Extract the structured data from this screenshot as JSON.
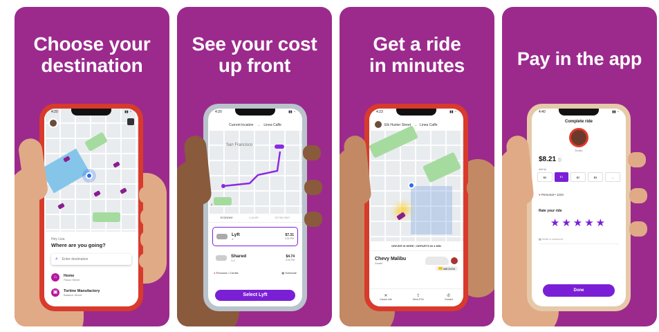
{
  "colors": {
    "panel_bg": "#9c2a8c",
    "accent_purple": "#7b1fd6",
    "phone_red": "#d83a2c",
    "phone_silver": "#b9c3cc",
    "phone_gold": "#e6c9a8"
  },
  "panels": [
    {
      "title": "Choose your\ndestination",
      "screen": {
        "status_time": "4:20",
        "greeting": "Hey Lisa",
        "question": "Where are you going?",
        "search_placeholder": "Enter destination",
        "places": [
          {
            "name": "Home",
            "sub": "Pasco Street",
            "icon": "home-icon"
          },
          {
            "name": "Tortine Manufactory",
            "sub": "Balance Street",
            "icon": "briefcase-icon"
          }
        ]
      }
    },
    {
      "title": "See your cost\nup front",
      "screen": {
        "status_time": "4:20",
        "route_from": "Current location",
        "route_to": "Linea Caffe",
        "map_label": "San Francisco",
        "modes": [
          "ECONOMY",
          "LUXURY",
          "EXTRA SEAT"
        ],
        "options": [
          {
            "name": "Lyft",
            "seats": "4",
            "price": "$7.31",
            "eta": "4:32 PM"
          },
          {
            "name": "Shared",
            "seats": "1-2",
            "price": "$4.74",
            "eta": "4:40 PM"
          }
        ],
        "payment": "Personal • Credits",
        "schedule": "Schedule",
        "cta": "Select Lyft"
      }
    },
    {
      "title": "Get a ride\nin minutes",
      "screen": {
        "status_time": "4:23",
        "route_from": "Elk Hunter Street",
        "route_to": "Linea Caffe",
        "banner": "DRIVER IS HERE • DEPARTS IN 4 MIN",
        "car": "Chevy Malibu",
        "driver": "Dustin",
        "plate": "ABC0234",
        "actions": [
          "Cancel ride",
          "Send ETA",
          "Contact"
        ]
      }
    },
    {
      "title": "Pay in the app",
      "screen": {
        "status_time": "4:40",
        "header": "Complete ride",
        "driver": "Dustin",
        "total": "$8.21",
        "tip_label": "Add tip",
        "tips": [
          "$0",
          "$1",
          "$2",
          "$5",
          "..."
        ],
        "payment": "Personal • 1234",
        "rate_label": "Rate your ride",
        "stars": "★★★★★",
        "comment_placeholder": "Write a comment",
        "cta": "Done"
      }
    }
  ]
}
